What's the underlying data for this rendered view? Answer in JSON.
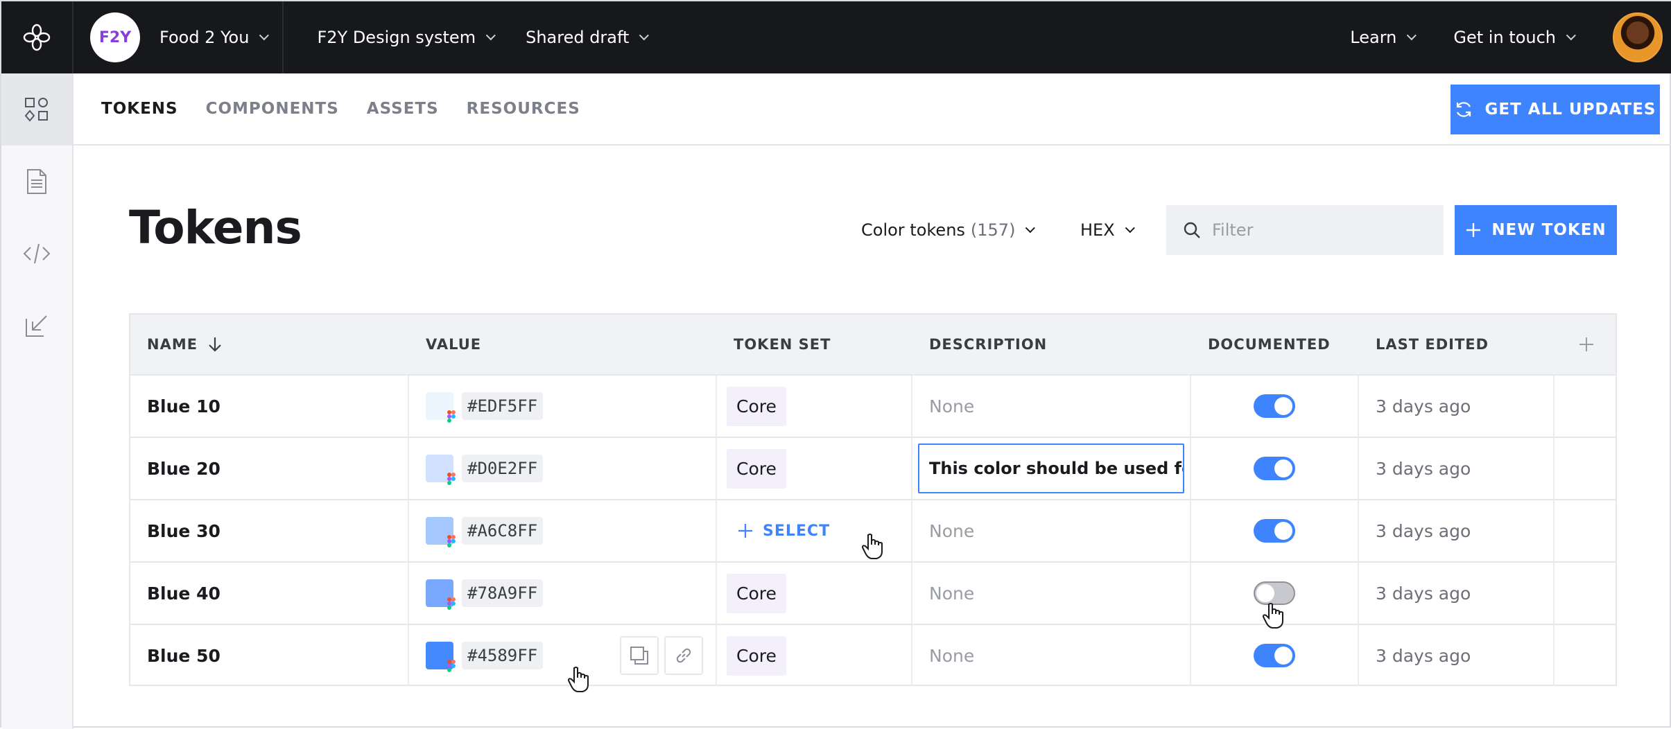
{
  "topbar": {
    "brand_avatar": "F2Y",
    "brand_name": "Food 2 You",
    "nav": [
      "F2Y Design system",
      "Shared draft"
    ],
    "right": [
      "Learn",
      "Get in touch"
    ]
  },
  "sidebar": {
    "items": [
      "components-icon",
      "document-icon",
      "code-icon",
      "import-icon"
    ]
  },
  "tabs": [
    "TOKENS",
    "COMPONENTS",
    "ASSETS",
    "RESOURCES"
  ],
  "updates_button": "GET ALL UPDATES",
  "page_title": "Tokens",
  "token_type": {
    "label": "Color tokens",
    "count": "(157)"
  },
  "format": "HEX",
  "filter_placeholder": "Filter",
  "new_token_button": "NEW TOKEN",
  "table": {
    "headers": [
      "NAME",
      "VALUE",
      "TOKEN SET",
      "DESCRIPTION",
      "DOCUMENTED",
      "LAST EDITED"
    ],
    "rows": [
      {
        "name": "Blue 10",
        "hex": "#EDF5FF",
        "token_set": "Core",
        "description": "None",
        "documented": true,
        "last_edited": "3 days ago"
      },
      {
        "name": "Blue 20",
        "hex": "#D0E2FF",
        "token_set": "Core",
        "description": "This color should be used for",
        "documented": true,
        "last_edited": "3 days ago"
      },
      {
        "name": "Blue 30",
        "hex": "#A6C8FF",
        "token_set": "SELECT",
        "description": "None",
        "documented": true,
        "last_edited": "3 days ago"
      },
      {
        "name": "Blue 40",
        "hex": "#78A9FF",
        "token_set": "Core",
        "description": "None",
        "documented": false,
        "last_edited": "3 days ago"
      },
      {
        "name": "Blue 50",
        "hex": "#4589FF",
        "token_set": "Core",
        "description": "None",
        "documented": true,
        "last_edited": "3 days ago"
      }
    ]
  },
  "colors": {
    "accent": "#3F84FF",
    "topbar": "#17181C",
    "brand_text": "#8A3DDE"
  }
}
